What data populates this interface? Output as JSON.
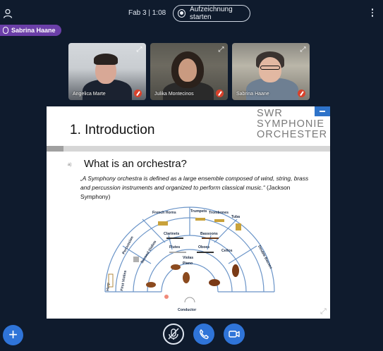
{
  "header": {
    "title": "Fab 3 | 1:08",
    "record_label": "Aufzeichnung starten"
  },
  "active_speaker": "Sabrina Haane",
  "participants": [
    {
      "name": "Angelica Marte"
    },
    {
      "name": "Julika Montecinos"
    },
    {
      "name": "Sabrina Haane"
    }
  ],
  "slide": {
    "title": "1. Introduction",
    "logo_lines": [
      "SWR",
      "SYMPHONIE",
      "ORCHESTER"
    ],
    "bullet_marker": "a)",
    "heading": "What is an orchestra?",
    "quote": "„A Symphony orchestra is defined as a large ensemble composed of wind, string, brass and percussion instruments and organized to perform classical music.“",
    "source": "(Jackson Symphony)",
    "diagram_labels": {
      "french_horns": "French Horns",
      "trumpets": "Trumpets",
      "trombones": "Trombones",
      "tuba": "Tuba",
      "clarinets": "Clarinets",
      "bassoons": "Bassoons",
      "flutes": "Flutes",
      "oboes": "Oboes",
      "percussion": "Percussion",
      "second_violins": "Second Violins",
      "first_violins": "First Violins",
      "harp": "Harp",
      "piano": "Piano",
      "violas": "Violas",
      "cellos": "Cellos",
      "double_basses": "Double Basses",
      "conductor": "Conductor"
    }
  },
  "icons": {
    "user": "user-icon",
    "menu": "more-vert-icon",
    "mic": "mic-muted-icon",
    "phone": "phone-icon",
    "camera": "camera-icon",
    "add": "plus-icon"
  },
  "colors": {
    "background": "#0f1b2d",
    "accent": "#2f74d8",
    "speaker_badge": "#6b3fa8",
    "muted": "#d9412b"
  }
}
